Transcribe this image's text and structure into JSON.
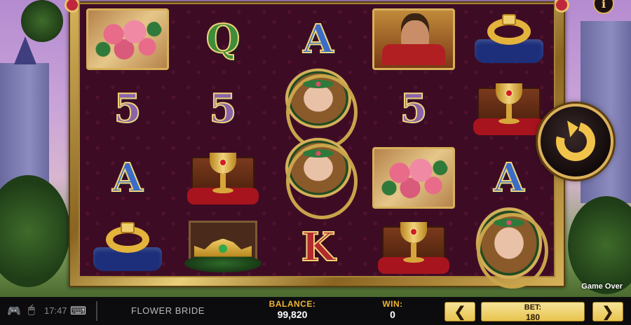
{
  "game": {
    "title": "FLOWER BRIDE",
    "status": "Game Over"
  },
  "system": {
    "clock": "17:47",
    "icons": [
      "gamepad-icon",
      "mouse-icon",
      "keyboard-icon"
    ]
  },
  "reels": [
    [
      "roses",
      "5",
      "A",
      "ring"
    ],
    [
      "Q",
      "5",
      "chalice",
      "crown"
    ],
    [
      "A",
      "bride",
      "bride",
      "K"
    ],
    [
      "king",
      "5",
      "roses",
      "chalice"
    ],
    [
      "ring",
      "chalice",
      "A",
      "bride"
    ]
  ],
  "symbols": {
    "letter_A": "A",
    "letter_Q": "Q",
    "letter_K": "K",
    "number_5": "5"
  },
  "controls": {
    "info_label": "i",
    "prev_bet": "❮",
    "next_bet": "❯"
  },
  "hud": {
    "balance_label": "BALANCE:",
    "balance_value": "99,820",
    "win_label": "WIN:",
    "win_value": "0",
    "bet_label": "BET:",
    "bet_value": "180"
  },
  "colors": {
    "accent_gold": "#f0b431",
    "frame_gold": "#d6b35a",
    "reel_bg": "#3d0c24"
  }
}
